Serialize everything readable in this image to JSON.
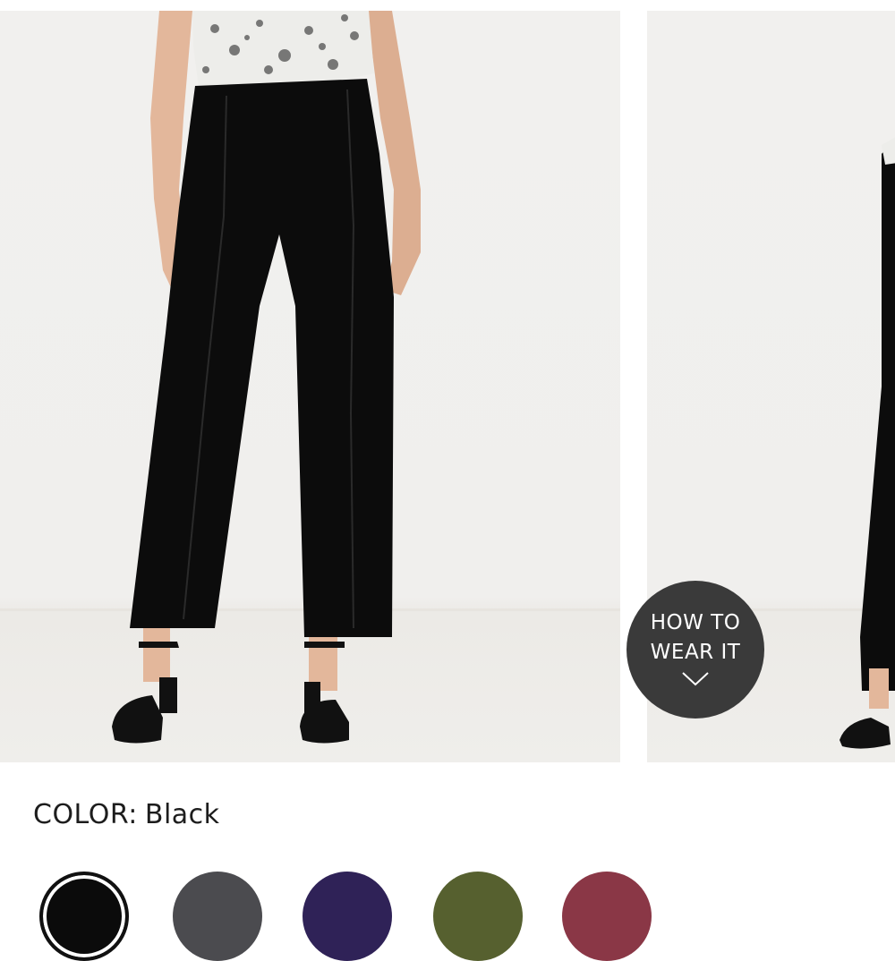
{
  "gallery": {
    "images": [
      {
        "alt": "Pintucked high waist pull on pants in Black - front view"
      },
      {
        "alt": "Pintucked high waist pull on pants in Black - side view"
      }
    ]
  },
  "how_to_wear": {
    "line1": "HOW TO",
    "line2": "WEAR IT",
    "icon": "chevron-down-icon"
  },
  "color": {
    "label": "COLOR:",
    "value": "Black"
  },
  "swatches": [
    {
      "name": "Black",
      "hex": "#0b0b0b",
      "selected": true
    },
    {
      "name": "Grey",
      "hex": "#4b4b4f",
      "selected": false
    },
    {
      "name": "Navy",
      "hex": "#2f2257",
      "selected": false
    },
    {
      "name": "Olive",
      "hex": "#56602f",
      "selected": false
    },
    {
      "name": "Burgundy",
      "hex": "#8a3746",
      "selected": false
    }
  ]
}
